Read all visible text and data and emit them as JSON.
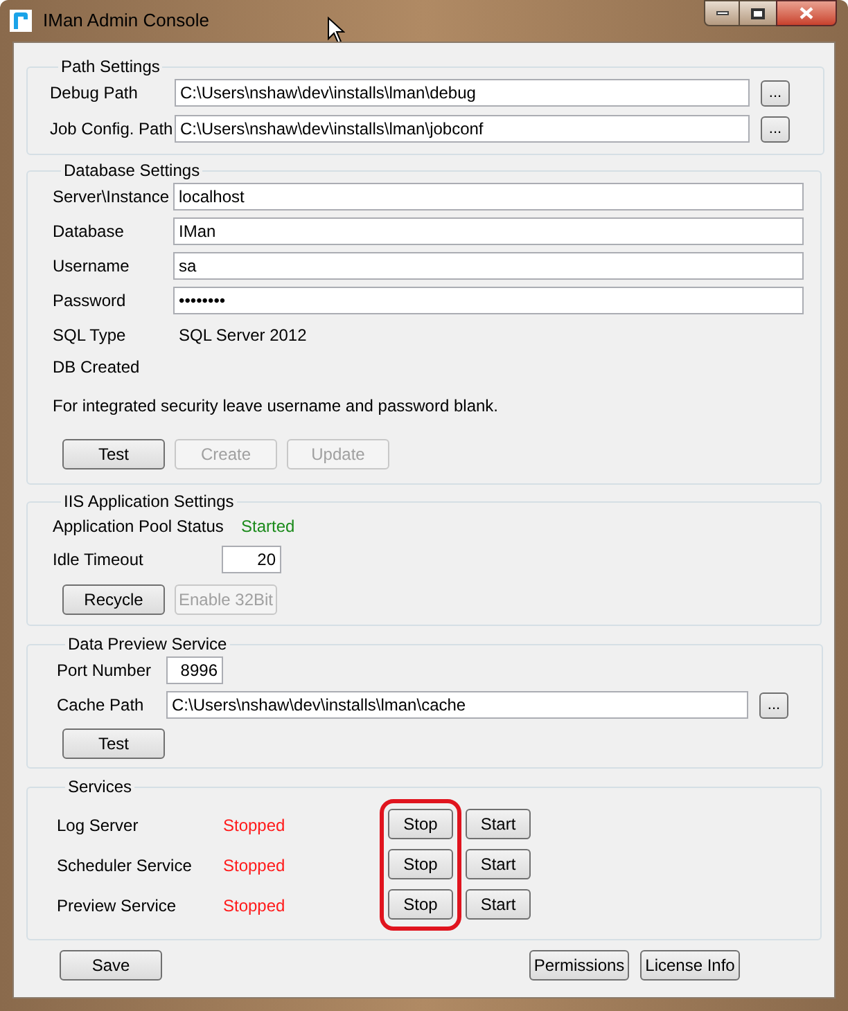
{
  "window": {
    "title": "IMan Admin Console"
  },
  "path_settings": {
    "title": "Path Settings",
    "fields": [
      {
        "label": "Debug Path",
        "value": "C:\\Users\\nshaw\\dev\\installs\\lman\\debug",
        "browse": "..."
      },
      {
        "label": "Job Config. Path",
        "value": "C:\\Users\\nshaw\\dev\\installs\\lman\\jobconf",
        "browse": "..."
      }
    ]
  },
  "database_settings": {
    "title": "Database Settings",
    "fields": [
      {
        "label": "Server\\Instance",
        "value": "localhost"
      },
      {
        "label": "Database",
        "value": "IMan"
      },
      {
        "label": "Username",
        "value": "sa"
      },
      {
        "label": "Password",
        "value": "••••••••"
      }
    ],
    "info": [
      {
        "label": "SQL Type",
        "value": "SQL Server 2012"
      },
      {
        "label": "DB Created"
      }
    ],
    "note": "For integrated security leave username and password blank.",
    "buttons": [
      {
        "label": "Test",
        "disabled": false
      },
      {
        "label": "Create",
        "disabled": true
      },
      {
        "label": "Update",
        "disabled": true
      }
    ]
  },
  "iis_settings": {
    "title": "IIS Application Settings",
    "pool_status": {
      "label": "Application Pool Status",
      "value": "Started",
      "running": true
    },
    "idle_timeout": {
      "label": "Idle Timeout",
      "value": "20"
    },
    "buttons": [
      {
        "label": "Recycle",
        "disabled": false
      },
      {
        "label": "Enable 32Bit",
        "disabled": true
      }
    ]
  },
  "data_preview": {
    "title": "Data Preview Service",
    "port": {
      "label": "Port Number",
      "value": "8996"
    },
    "cache_path": {
      "label": "Cache Path",
      "value": "C:\\Users\\nshaw\\dev\\installs\\lman\\cache",
      "browse": "..."
    },
    "buttons": [
      {
        "label": "Test",
        "disabled": false
      }
    ]
  },
  "services": {
    "title": "Services",
    "stop_column_highlighted": true,
    "items": [
      {
        "name": "Log Server",
        "status": "Stopped",
        "running": false,
        "stop": "Stop",
        "start": "Start"
      },
      {
        "name": "Scheduler Service",
        "status": "Stopped",
        "running": false,
        "stop": "Stop",
        "start": "Start"
      },
      {
        "name": "Preview Service",
        "status": "Stopped",
        "running": false,
        "stop": "Stop",
        "start": "Start"
      }
    ]
  },
  "footer": {
    "left_buttons": [
      {
        "label": "Save",
        "disabled": false
      }
    ],
    "right_buttons": [
      {
        "label": "Permissions",
        "disabled": false
      },
      {
        "label": "License Info",
        "disabled": false
      }
    ]
  }
}
